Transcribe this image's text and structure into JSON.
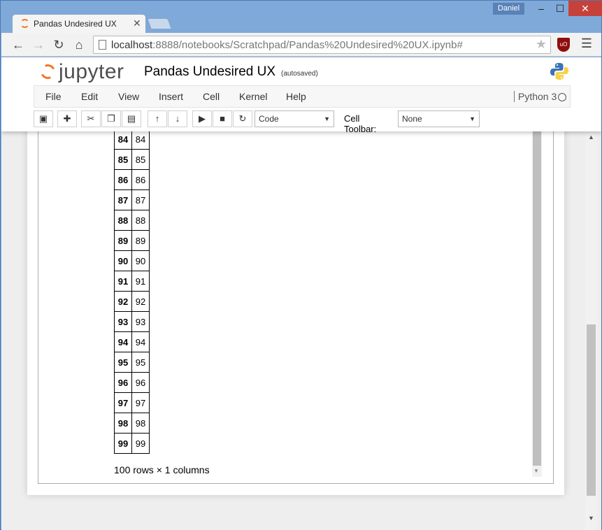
{
  "browser": {
    "tab_title": "Pandas Undesired UX",
    "user": "Daniel",
    "url_host": "localhost",
    "url_rest": ":8888/notebooks/Scratchpad/Pandas%20Undesired%20UX.ipynb#",
    "window_buttons": {
      "minimize": "–",
      "maximize": "☐",
      "close": "✕"
    },
    "ublock_label": "uO"
  },
  "jupyter": {
    "logo_text": "jupyter",
    "notebook_name": "Pandas Undesired UX",
    "autosave_status": "(autosaved)",
    "menu": [
      "File",
      "Edit",
      "View",
      "Insert",
      "Cell",
      "Kernel",
      "Help"
    ],
    "kernel": "Python 3",
    "cell_type": "Code",
    "cell_toolbar_label": "Cell Toolbar:",
    "cell_toolbar_value": "None"
  },
  "output": {
    "rows": [
      [
        "84",
        "84"
      ],
      [
        "85",
        "85"
      ],
      [
        "86",
        "86"
      ],
      [
        "87",
        "87"
      ],
      [
        "88",
        "88"
      ],
      [
        "89",
        "89"
      ],
      [
        "90",
        "90"
      ],
      [
        "91",
        "91"
      ],
      [
        "92",
        "92"
      ],
      [
        "93",
        "93"
      ],
      [
        "94",
        "94"
      ],
      [
        "95",
        "95"
      ],
      [
        "96",
        "96"
      ],
      [
        "97",
        "97"
      ],
      [
        "98",
        "98"
      ],
      [
        "99",
        "99"
      ]
    ],
    "shape_text": "100 rows × 1 columns"
  },
  "colors": {
    "jupyter_orange": "#f37726",
    "close_red": "#c7413b"
  }
}
